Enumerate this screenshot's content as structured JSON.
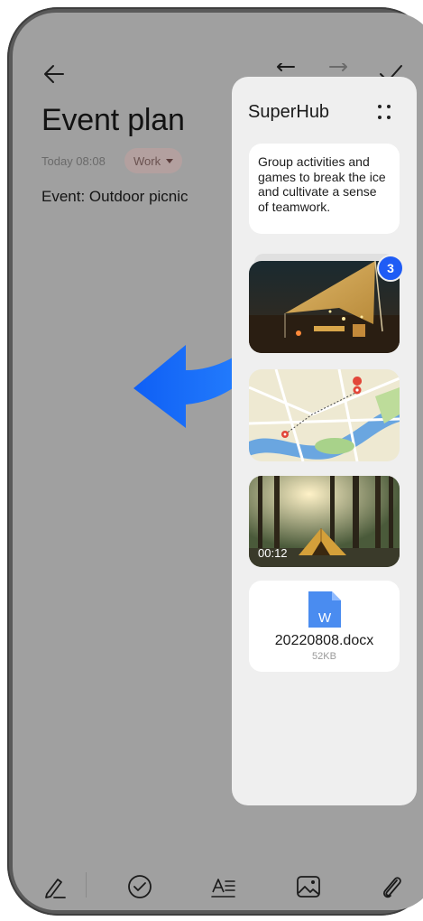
{
  "note": {
    "title": "Event plan",
    "timestamp": "Today 08:08",
    "tag": "Work",
    "body": "Event: Outdoor picnic"
  },
  "toolbar_icons": [
    "back-icon",
    "undo-icon",
    "redo-icon",
    "done-icon"
  ],
  "bottom_bar_icons": [
    "handwriting-icon",
    "checklist-icon",
    "text-style-icon",
    "image-icon",
    "attachment-icon"
  ],
  "superhub": {
    "title": "SuperHub",
    "menu_icon": "grid-dots-icon",
    "items": {
      "text_clip": "Group activities and games to break the ice and cultivate a sense of teamwork.",
      "photo_stack_count": "3",
      "video_duration": "00:12",
      "file_name": "20220808.docx",
      "file_size": "52KB",
      "file_icon_letter": "W"
    }
  },
  "colors": {
    "badge": "#1f5cf5",
    "drag_arrow": "#1a6dff",
    "file_icon": "#4a8cf0"
  }
}
